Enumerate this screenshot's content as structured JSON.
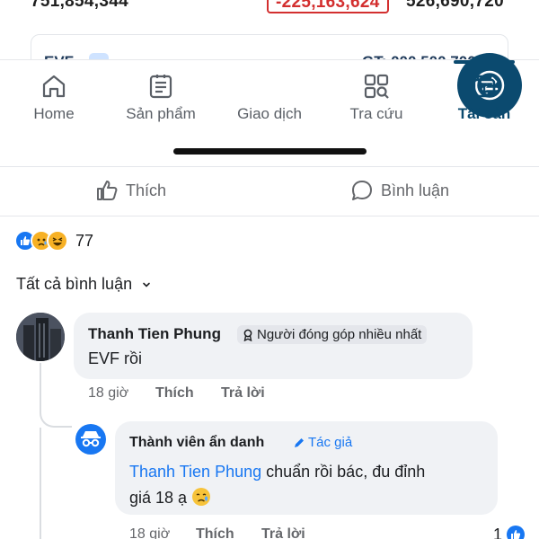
{
  "stats": {
    "left_value": "751,854,344",
    "middle_value": "-225,163,624",
    "right_value": "526,690,720"
  },
  "card": {
    "code": "EVF",
    "right_text": "GT: 000,500,700"
  },
  "bottom_nav": {
    "items": [
      {
        "label": "Home",
        "icon": "home-icon"
      },
      {
        "label": "Sản phẩm",
        "icon": "document-list-icon"
      },
      {
        "label": "Giao dịch",
        "icon": "swap-arrows-icon"
      },
      {
        "label": "Tra cứu",
        "icon": "search-grid-icon"
      },
      {
        "label": "Tài sản",
        "icon": "wallet-icon"
      }
    ],
    "active_index": 4,
    "accent_color": "#0b4a6f"
  },
  "post": {
    "like_label": "Thích",
    "comment_label": "Bình luận",
    "reaction_count": "77",
    "reactions": [
      "like-icon",
      "sad-icon",
      "haha-icon"
    ],
    "filter_label": "Tất cả bình luận"
  },
  "comments": [
    {
      "author": "Thanh Tien Phung",
      "badge": "Người đóng góp nhiều nhất",
      "text": "EVF rồi",
      "time": "18 giờ",
      "like_action": "Thích",
      "reply_action": "Trả lời"
    }
  ],
  "reply": {
    "author": "Thành viên ẩn danh",
    "badge": "Tác giả",
    "mention": "Thanh Tien Phung",
    "text_line1": " chuẩn rồi bác, đu đỉnh",
    "text_line2": "giá 18 ạ",
    "time": "18 giờ",
    "like_action": "Thích",
    "reply_action": "Trả lời",
    "like_count": "1"
  },
  "colors": {
    "fb_blue": "#1877f2",
    "negative_red": "#d32f2f",
    "bubble_bg": "#f0f2f5"
  }
}
